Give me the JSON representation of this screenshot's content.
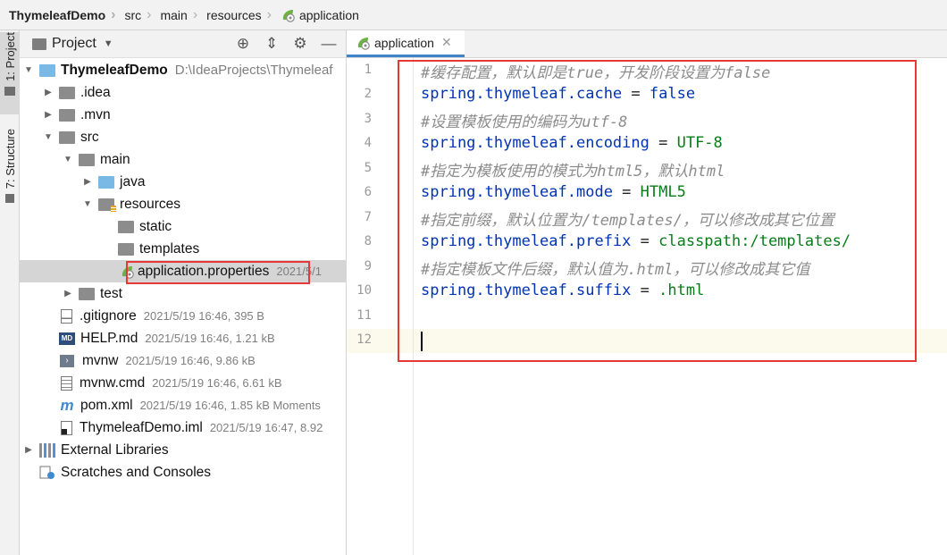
{
  "breadcrumb": {
    "items": [
      "ThymeleafDemo",
      "src",
      "main",
      "resources",
      "application"
    ]
  },
  "side_strip": {
    "project_tab": "1: Project",
    "structure_tab": "7: Structure"
  },
  "project_panel": {
    "title": "Project",
    "tree": [
      {
        "name": "ThymeleafDemo",
        "meta": "D:\\IdeaProjects\\Thymeleaf"
      },
      {
        "name": ".idea"
      },
      {
        "name": ".mvn"
      },
      {
        "name": "src"
      },
      {
        "name": "main"
      },
      {
        "name": "java"
      },
      {
        "name": "resources"
      },
      {
        "name": "static"
      },
      {
        "name": "templates"
      },
      {
        "name": "application.properties",
        "meta": "2021/5/1"
      },
      {
        "name": "test"
      },
      {
        "name": ".gitignore",
        "meta": "2021/5/19 16:46, 395 B"
      },
      {
        "name": "HELP.md",
        "meta": "2021/5/19 16:46, 1.21 kB"
      },
      {
        "name": "mvnw",
        "meta": "2021/5/19 16:46, 9.86 kB"
      },
      {
        "name": "mvnw.cmd",
        "meta": "2021/5/19 16:46, 6.61 kB"
      },
      {
        "name": "pom.xml",
        "meta": "2021/5/19 16:46, 1.85 kB Moments"
      },
      {
        "name": "ThymeleafDemo.iml",
        "meta": "2021/5/19 16:47, 8.92"
      },
      {
        "name": "External Libraries"
      },
      {
        "name": "Scratches and Consoles"
      }
    ]
  },
  "editor": {
    "tab_label": "application",
    "line_numbers": [
      "1",
      "2",
      "3",
      "4",
      "5",
      "6",
      "7",
      "8",
      "9",
      "10",
      "11",
      "12"
    ],
    "lines": [
      {
        "comment": "#缓存配置，默认即是true，开发阶段设置为false"
      },
      {
        "key": "spring.thymeleaf.cache",
        "eq": " = ",
        "val": "false",
        "val_kind": "kw"
      },
      {
        "comment": "#设置模板使用的编码为utf-8"
      },
      {
        "key": "spring.thymeleaf.encoding",
        "eq": " = ",
        "val": "UTF-8",
        "val_kind": "val"
      },
      {
        "comment": "#指定为模板使用的模式为html5，默认html"
      },
      {
        "key": "spring.thymeleaf.mode",
        "eq": " = ",
        "val": "HTML5",
        "val_kind": "val"
      },
      {
        "comment": "#指定前缀，默认位置为/templates/，可以修改成其它位置"
      },
      {
        "key": "spring.thymeleaf.prefix",
        "eq": " = ",
        "val": "classpath:/templates/",
        "val_kind": "val"
      },
      {
        "comment": "#指定模板文件后缀，默认值为.html，可以修改成其它值"
      },
      {
        "key": "spring.thymeleaf.suffix",
        "eq": " = ",
        "val": ".html",
        "val_kind": "val"
      },
      {},
      {}
    ]
  }
}
